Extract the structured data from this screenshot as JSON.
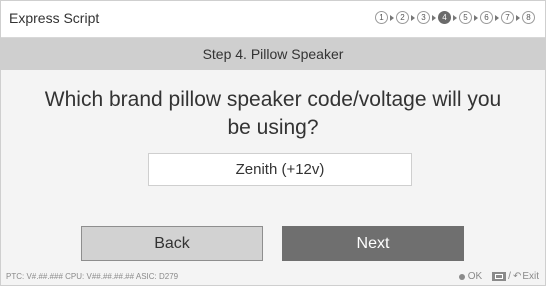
{
  "app": {
    "title": "Express Script"
  },
  "steps": {
    "items": [
      "1",
      "2",
      "3",
      "4",
      "5",
      "6",
      "7",
      "8"
    ],
    "active_index": 3
  },
  "header": {
    "title": "Step 4. Pillow Speaker"
  },
  "question": {
    "text": "Which brand pillow speaker code/voltage will you be using?"
  },
  "selection": {
    "value": "Zenith (+12v)"
  },
  "buttons": {
    "back": "Back",
    "next": "Next"
  },
  "footer": {
    "info": "PTC: V#.##.### CPU: V##.##.##.## ASIC: D279",
    "ok": "OK",
    "exit": "Exit",
    "separator": "/"
  },
  "colors": {
    "header_bg": "#cfcfcf",
    "next_button": "#6f6f6f",
    "back_button": "#d2d2d2",
    "active_step": "#6a6a6a"
  }
}
